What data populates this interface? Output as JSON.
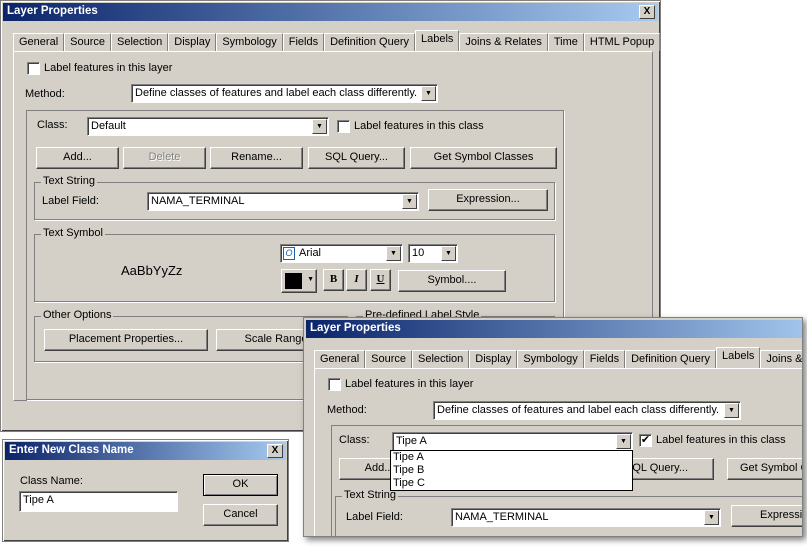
{
  "main": {
    "title": "Layer Properties",
    "tabs": [
      "General",
      "Source",
      "Selection",
      "Display",
      "Symbology",
      "Fields",
      "Definition Query",
      "Labels",
      "Joins & Relates",
      "Time",
      "HTML Popup"
    ],
    "active_tab": "Labels",
    "label_layer": "Label features in this layer",
    "label_layer_checked": false,
    "method_label": "Method:",
    "method_value": "Define classes of features and label each class differently.",
    "class_label": "Class:",
    "class_value": "Default",
    "label_class": "Label features in this class",
    "label_class_checked": false,
    "buttons": {
      "add": "Add...",
      "delete": "Delete",
      "rename": "Rename...",
      "sql": "SQL Query...",
      "get_symbol": "Get Symbol Classes"
    },
    "text_string": "Text String",
    "label_field_label": "Label Field:",
    "label_field_value": "NAMA_TERMINAL",
    "expression": "Expression...",
    "text_symbol": "Text Symbol",
    "preview": "AaBbYyZz",
    "font": "Arial",
    "size": "10",
    "bold": "B",
    "italic": "I",
    "underline": "U",
    "symbol": "Symbol....",
    "other_options": "Other Options",
    "placement": "Placement Properties...",
    "scale_range": "Scale Range",
    "predefined": "Pre-defined Label Style",
    "close": "X"
  },
  "newclass": {
    "title": "Enter New Class Name",
    "label": "Class Name:",
    "value": "Tipe A",
    "ok": "OK",
    "cancel": "Cancel",
    "close": "X"
  },
  "second": {
    "title": "Layer Properties",
    "tabs": [
      "General",
      "Source",
      "Selection",
      "Display",
      "Symbology",
      "Fields",
      "Definition Query",
      "Labels",
      "Joins & Relates"
    ],
    "label_layer": "Label features in this layer",
    "method_label": "Method:",
    "method_value": "Define classes of features and label each class differently.",
    "class_label": "Class:",
    "class_value": "Tipe A",
    "label_class": "Label features in this class",
    "label_class_checked": true,
    "options": [
      "Tipe A",
      "Tipe B",
      "Tipe C"
    ],
    "add": "Add...",
    "sql": "SQL Query...",
    "get_symbol": "Get Symbol Classes",
    "text_string": "Text String",
    "label_field_label": "Label Field:",
    "label_field_value": "NAMA_TERMINAL",
    "expression": "Expression..."
  },
  "colors": {
    "title_start": "#0a246a",
    "title_end": "#a6caf0",
    "face": "#d4d0c8"
  }
}
